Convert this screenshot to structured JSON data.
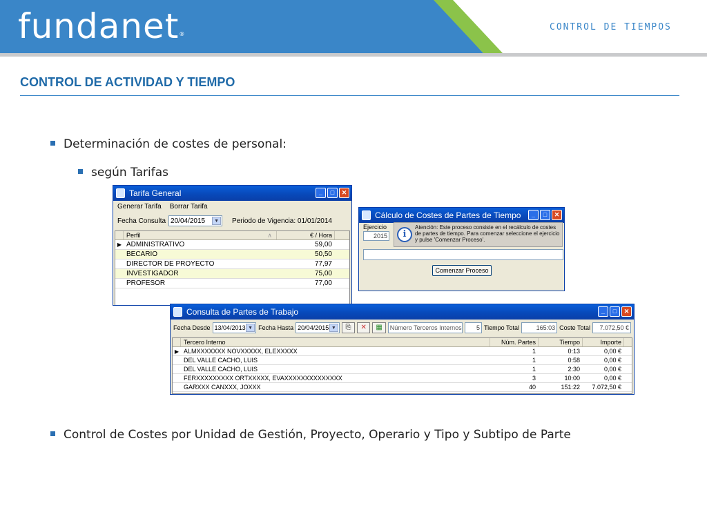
{
  "header": {
    "logo_text": "fundanet",
    "logo_reg": "®",
    "section_label": "CONTROL DE TIEMPOS",
    "colors": {
      "blue": "#3a86c8",
      "green": "#8bc34a",
      "gray": "#c9cacc"
    }
  },
  "page_title": "CONTROL DE ACTIVIDAD Y TIEMPO",
  "bullets": {
    "b1": "Determinación de costes de personal:",
    "b2": "según Tarifas",
    "b3": "Control de Costes por Unidad de Gestión, Proyecto, Operario y Tipo y Subtipo de Parte"
  },
  "tarifa": {
    "title": "Tarifa General",
    "menu": [
      "Generar Tarifa",
      "Borrar Tarifa"
    ],
    "fecha_label": "Fecha Consulta",
    "fecha_value": "20/04/2015",
    "vigencia": "Periodo de Vigencia: 01/01/2014",
    "col_perfil": "Perfil",
    "col_sort": "∧",
    "col_hora": "€ / Hora",
    "rows": [
      {
        "perfil": "ADMINISTRATIVO",
        "valor": "59,00"
      },
      {
        "perfil": "BECARIO",
        "valor": "50,50"
      },
      {
        "perfil": "DIRECTOR DE PROYECTO",
        "valor": "77,97"
      },
      {
        "perfil": "INVESTIGADOR",
        "valor": "75,00"
      },
      {
        "perfil": "PROFESOR",
        "valor": "77,00"
      }
    ]
  },
  "calculo": {
    "title": "Cálculo de Costes de Partes de Tiempo",
    "ejercicio_label": "Ejercicio",
    "ejercicio_value": "2015",
    "info_text": "Atención: Este proceso consiste en el recálculo de costes de partes de tiempo.  Para comenzar seleccione el ejercicio y pulse 'Comenzar Proceso'.",
    "button": "Comenzar Proceso"
  },
  "consulta": {
    "title": "Consulta de Partes de Trabajo",
    "desde_label": "Fecha Desde",
    "desde_value": "13/04/2013",
    "hasta_label": "Fecha Hasta",
    "hasta_value": "20/04/2015",
    "num_label": "Número Terceros Internos",
    "num_value": "5",
    "tiempo_label": "Tiempo Total",
    "tiempo_value": "165:03",
    "coste_label": "Coste Total",
    "coste_value": "7.072,50 €",
    "cols": [
      "Tercero Interno",
      "Núm. Partes",
      "Tiempo",
      "Importe"
    ],
    "rows": [
      {
        "t": "ALMXXXXXXX NOVXXXXX, ELEXXXXX",
        "n": "1",
        "ti": "0:13",
        "i": "0,00 €"
      },
      {
        "t": "DEL VALLE CACHO, LUIS",
        "n": "1",
        "ti": "0:58",
        "i": "0,00 €"
      },
      {
        "t": "DEL VALLE CACHO, LUIS",
        "n": "1",
        "ti": "2:30",
        "i": "0,00 €"
      },
      {
        "t": "FERXXXXXXXXX ORTXXXXX, EVAXXXXXXXXXXXXXX",
        "n": "3",
        "ti": "10:00",
        "i": "0,00 €"
      },
      {
        "t": "GARXXX CANXXX, JOXXX",
        "n": "40",
        "ti": "151:22",
        "i": "7.072,50 €"
      }
    ]
  }
}
